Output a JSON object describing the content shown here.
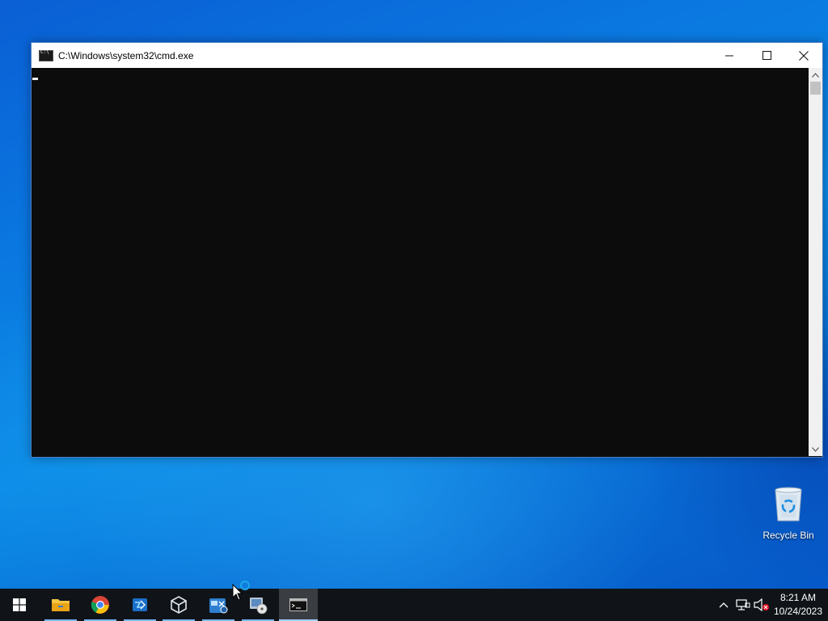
{
  "window": {
    "title": "C:\\Windows\\system32\\cmd.exe",
    "console_text": ""
  },
  "desktop": {
    "recycle_bin_label": "Recycle Bin"
  },
  "taskbar": {
    "items": [
      {
        "name": "start",
        "icon": "windows-logo-icon"
      },
      {
        "name": "file-explorer",
        "icon": "folder-icon"
      },
      {
        "name": "chrome",
        "icon": "chrome-icon"
      },
      {
        "name": "app-blue",
        "icon": "network-app-icon"
      },
      {
        "name": "virtualbox",
        "icon": "cube-icon"
      },
      {
        "name": "app-7",
        "icon": "settings-app-icon"
      },
      {
        "name": "disc-app",
        "icon": "disc-icon"
      },
      {
        "name": "cmd",
        "icon": "terminal-icon",
        "active": true
      }
    ],
    "clock": {
      "time": "8:21 AM",
      "date": "10/24/2023"
    }
  },
  "colors": {
    "console_bg": "#0c0c0c",
    "taskbar_bg": "#101418",
    "accent": "#76b9ed"
  }
}
